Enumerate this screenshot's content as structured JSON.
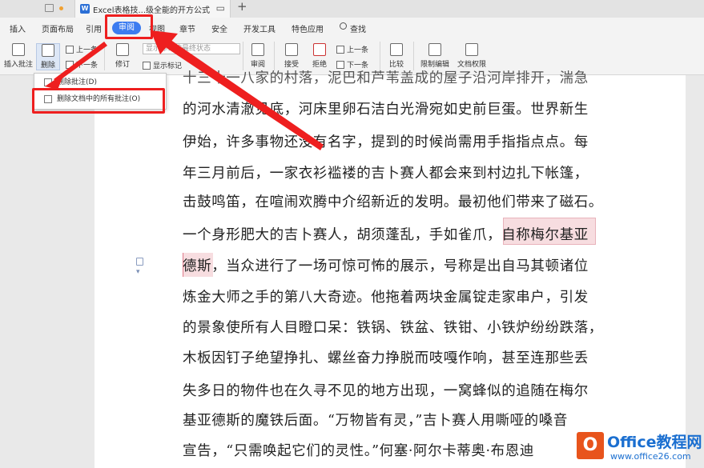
{
  "titlebar": {
    "doc_tab_title": "Excel表格技...级全能的开方公式",
    "new_tab": "+"
  },
  "menu": {
    "items": [
      "插入",
      "页面布局",
      "引用",
      "审阅",
      "视图",
      "章节",
      "安全",
      "开发工具",
      "特色应用",
      "查找"
    ],
    "active": "审阅"
  },
  "ribbon": {
    "insert_comment": "插入批注",
    "delete": "删除",
    "prev_comment": "上一条",
    "next_comment": "下一条",
    "track": "修订",
    "show_markup_dropdown": "显示标记的最终状态",
    "show_markup": "显示标记",
    "review": "审阅",
    "accept": "接受",
    "reject": "拒绝",
    "prev_change": "上一条",
    "next_change": "下一条",
    "compare": "比较",
    "restrict_edit": "限制编辑",
    "doc_permission": "文档权限"
  },
  "dropdown": {
    "items": [
      "删除批注(D)",
      "删除文档中的所有批注(O)"
    ]
  },
  "document": {
    "lines": [
      "十三十一八家的村落，泥巴和芦苇盖成的屋子沿河岸排开，湍急",
      "的河水清澈见底，河床里卵石洁白光滑宛如史前巨蛋。世界新生",
      "伊始，许多事物还没有名字，提到的时候尚需用手指指点点。每",
      "年三月前后，一家衣衫褴褛的吉卜赛人都会来到村边扎下帐篷，",
      "击鼓鸣笛，在喧闹欢腾中介绍新近的发明。最初他们带来了磁石。",
      "一个身形肥大的吉卜赛人，胡须蓬乱，手如雀爪，",
      "自称梅尔基亚",
      "德斯",
      "，当众进行了一场可惊可怖的展示，号称是出自马其顿诸位",
      "炼金大师之手的第八大奇迹。他拖着两块金属锭走家串户，引发",
      "的景象使所有人目瞪口呆：铁锅、铁盆、铁钳、小铁炉纷纷跌落，",
      "木板因钉子绝望挣扎、螺丝奋力挣脱而吱嘎作响，甚至连那些丢",
      "失多日的物件也在久寻不见的地方出现，一窝蜂似的追随在梅尔",
      "基亚德斯的魔铁后面。“万物皆有灵，”吉卜赛人用嘶哑的嗓音",
      "宣告，“只需唤起它们的灵性。”何塞·阿尔卡蒂奥·布恩迪"
    ]
  },
  "watermark": {
    "logo_letter": "O",
    "brand": "Office教程网",
    "url": "www.office26.com"
  },
  "colors": {
    "accent": "#3c7cf0",
    "annotation_red": "#ee1f1f",
    "highlight": "#f7dde0",
    "watermark_blue": "#1b6fd0",
    "watermark_orange": "#e8541c"
  }
}
